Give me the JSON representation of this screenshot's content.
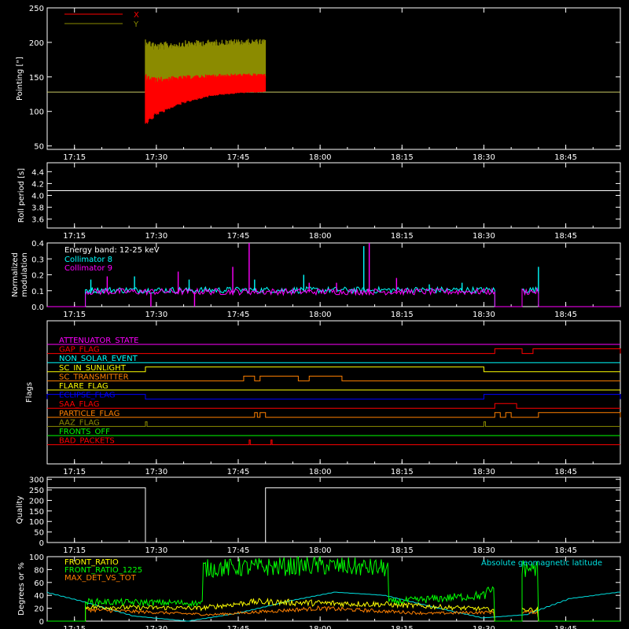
{
  "chart_data": [
    {
      "id": "pointing",
      "type": "line",
      "ylabel": "Pointing [\"]",
      "ylim": [
        45,
        250
      ],
      "yticks": [
        50,
        100,
        150,
        200,
        250
      ],
      "xlim": [
        "17:10",
        "18:55"
      ],
      "xticks": [
        "17:15",
        "17:30",
        "17:45",
        "18:00",
        "18:15",
        "18:30",
        "18:45"
      ],
      "legend": "top-left",
      "series": [
        {
          "name": "X",
          "color": "#ff0000",
          "t_start": "17:28",
          "t_end": "17:50",
          "points": [
            [
              "17:28",
              100
            ],
            [
              "17:30",
              118
            ],
            [
              "17:35",
              130
            ],
            [
              "17:40",
              136
            ],
            [
              "17:45",
              139
            ],
            [
              "17:50",
              140
            ]
          ],
          "band_high": [
            [
              "17:28",
              155
            ],
            [
              "17:30",
              150
            ],
            [
              "17:35",
              152
            ],
            [
              "17:40",
              154
            ],
            [
              "17:45",
              155
            ],
            [
              "17:50",
              155
            ]
          ],
          "band_low": [
            [
              "17:28",
              82
            ],
            [
              "17:30",
              95
            ],
            [
              "17:35",
              112
            ],
            [
              "17:40",
              122
            ],
            [
              "17:45",
              126
            ],
            [
              "17:50",
              128
            ]
          ]
        },
        {
          "name": "Y",
          "color": "#8b8b00",
          "t_start": "17:28",
          "t_end": "17:50",
          "band_high": [
            [
              "17:28",
              208
            ],
            [
              "17:30",
              200
            ],
            [
              "17:35",
              203
            ],
            [
              "17:40",
              204
            ],
            [
              "17:45",
              205
            ],
            [
              "17:50",
              205
            ]
          ],
          "band_low": [
            [
              "17:28",
              125
            ],
            [
              "17:30",
              120
            ],
            [
              "17:35",
              135
            ],
            [
              "17:40",
              142
            ],
            [
              "17:45",
              146
            ],
            [
              "17:50",
              148
            ]
          ]
        }
      ],
      "reference_line": {
        "value": 128,
        "color": "#c8c864"
      }
    },
    {
      "id": "roll",
      "type": "line",
      "ylabel": "Roll period [s]",
      "ylim": [
        3.45,
        4.55
      ],
      "yticks": [
        3.6,
        3.8,
        4.0,
        4.2,
        4.4
      ],
      "xticks": [
        "17:15",
        "17:30",
        "17:45",
        "18:00",
        "18:15",
        "18:30",
        "18:45"
      ],
      "series": [
        {
          "name": "",
          "color": "#ffffff",
          "points": [
            [
              "17:10",
              4.08
            ],
            [
              "18:55",
              4.08
            ]
          ]
        }
      ]
    },
    {
      "id": "modulation",
      "type": "line",
      "ylabel_lines": [
        "Normalized",
        "modulation"
      ],
      "ylim": [
        0,
        0.4
      ],
      "yticks": [
        0.0,
        0.1,
        0.2,
        0.3,
        0.4
      ],
      "xticks": [
        "17:15",
        "17:30",
        "17:45",
        "18:00",
        "18:15",
        "18:30",
        "18:45"
      ],
      "legend_text": "Energy band: 12-25 keV",
      "series": [
        {
          "name": "Collimator 8",
          "color": "#00ffff",
          "active": [
            [
              "17:17",
              "18:32"
            ],
            [
              "18:37",
              "18:40"
            ]
          ],
          "base": 0.1,
          "spikes": [
            [
              "17:18",
              0.17
            ],
            [
              "17:26",
              0.19
            ],
            [
              "17:36",
              0.17
            ],
            [
              "17:48",
              0.17
            ],
            [
              "17:57",
              0.2
            ],
            [
              "18:08",
              0.38
            ],
            [
              "18:20",
              0.14
            ],
            [
              "18:26",
              0.15
            ],
            [
              "18:40",
              0.25
            ]
          ]
        },
        {
          "name": "Collimator 9",
          "color": "#ff00ff",
          "active": [
            [
              "17:17",
              "18:32"
            ],
            [
              "18:37",
              "18:40"
            ]
          ],
          "base": 0.09,
          "spikes": [
            [
              "17:21",
              0.19
            ],
            [
              "17:34",
              0.22
            ],
            [
              "17:44",
              0.25
            ],
            [
              "17:47",
              0.4
            ],
            [
              "17:58",
              0.15
            ],
            [
              "18:03",
              0.15
            ],
            [
              "18:09",
              0.4
            ],
            [
              "18:14",
              0.18
            ]
          ],
          "dips": [
            "17:29",
            "17:37"
          ]
        }
      ]
    },
    {
      "id": "flags",
      "type": "line",
      "ylabel": "Flags",
      "xticks": [
        "17:15",
        "17:30",
        "17:45",
        "18:00",
        "18:15",
        "18:30",
        "18:45"
      ],
      "series": [
        {
          "name": "ATTENUATOR_STATE",
          "color": "#ff00ff",
          "on": []
        },
        {
          "name": "GAP_FLAG",
          "color": "#ff0000",
          "on": [
            [
              "18:32",
              "18:37"
            ],
            [
              "18:39",
              "18:55"
            ]
          ]
        },
        {
          "name": "NON_SOLAR_EVENT",
          "color": "#00ffff",
          "on": []
        },
        {
          "name": "SC_IN_SUNLIGHT",
          "color": "#ffff00",
          "on": [
            [
              "17:28",
              "18:30"
            ]
          ]
        },
        {
          "name": "SC_TRANSMITTER",
          "color": "#ff8000",
          "on": [
            [
              "17:46",
              "17:48"
            ],
            [
              "17:49",
              "17:56"
            ],
            [
              "17:58",
              "18:04"
            ]
          ]
        },
        {
          "name": "FLARE_FLAG",
          "color": "#ffff00",
          "on": []
        },
        {
          "name": "ECLIPSE_FLAG",
          "color": "#0000ff",
          "on": [
            [
              "17:10",
              "17:28"
            ],
            [
              "18:30",
              "18:55"
            ]
          ]
        },
        {
          "name": "SAA_FLAG",
          "color": "#ff0000",
          "on": [
            [
              "18:32",
              "18:36"
            ]
          ]
        },
        {
          "name": "PARTICLE_FLAG",
          "color": "#ff8000",
          "on": [
            [
              "17:48",
              "17:48.5"
            ],
            [
              "17:49",
              "17:50"
            ],
            [
              "18:32",
              "18:33"
            ],
            [
              "18:34",
              "18:35"
            ],
            [
              "18:40",
              "18:55"
            ]
          ]
        },
        {
          "name": "AAZ_FLAG",
          "color": "#8b8b00",
          "on": [
            [
              "17:28",
              "17:28.3"
            ],
            [
              "18:30",
              "18:30.3"
            ]
          ]
        },
        {
          "name": "FRONTS_OFF",
          "color": "#00ff00",
          "on": []
        },
        {
          "name": "BAD_PACKETS",
          "color": "#ff0000",
          "on": [
            [
              "17:47",
              "17:47.2"
            ],
            [
              "17:51",
              "17:51.2"
            ]
          ]
        }
      ]
    },
    {
      "id": "quality",
      "type": "line",
      "ylabel": "Quality",
      "ylim": [
        0,
        310
      ],
      "yticks": [
        0,
        50,
        100,
        150,
        200,
        250,
        300
      ],
      "xticks": [
        "17:15",
        "17:30",
        "17:45",
        "18:00",
        "18:15",
        "18:30",
        "18:45"
      ],
      "series": [
        {
          "name": "",
          "color": "#ffffff",
          "points": [
            [
              "17:10",
              260
            ],
            [
              "17:28",
              260
            ],
            [
              "17:28",
              0
            ],
            [
              "17:50",
              0
            ],
            [
              "17:50",
              260
            ],
            [
              "18:55",
              260
            ]
          ]
        }
      ]
    },
    {
      "id": "ratios",
      "type": "line",
      "ylabel": "Degrees or %",
      "ylim": [
        0,
        100
      ],
      "yticks": [
        0,
        20,
        40,
        60,
        80,
        100
      ],
      "xticks": [
        "17:15",
        "17:30",
        "17:45",
        "18:00",
        "18:15",
        "18:30",
        "18:45"
      ],
      "series": [
        {
          "name": "FRONT_RATIO",
          "color": "#ffff00",
          "active": [
            [
              "17:17",
              "18:32"
            ],
            [
              "18:37",
              "18:40"
            ]
          ],
          "levels": [
            [
              "17:17",
              22
            ],
            [
              "17:38",
              20
            ],
            [
              "17:48",
              30
            ],
            [
              "18:00",
              28
            ],
            [
              "18:12",
              26
            ],
            [
              "18:32",
              18
            ]
          ]
        },
        {
          "name": "FRONT_RATIO_1225",
          "color": "#00ff00",
          "active": [
            [
              "17:17",
              "18:32"
            ],
            [
              "18:37",
              "18:40"
            ]
          ],
          "levels": [
            [
              "17:17",
              30
            ],
            [
              "17:38",
              28
            ],
            [
              "17:39",
              82
            ],
            [
              "17:50",
              84
            ],
            [
              "18:00",
              86
            ],
            [
              "18:12",
              82
            ],
            [
              "18:13",
              30
            ],
            [
              "18:30",
              40
            ],
            [
              "18:37",
              82
            ],
            [
              "18:40",
              82
            ]
          ]
        },
        {
          "name": "MAX_DET_VS_TOT",
          "color": "#ff8000",
          "active": [
            [
              "17:17",
              "18:32"
            ],
            [
              "18:37",
              "18:40"
            ]
          ],
          "levels": [
            [
              "17:17",
              18
            ],
            [
              "17:40",
              10
            ],
            [
              "18:00",
              20
            ],
            [
              "18:20",
              12
            ],
            [
              "18:32",
              14
            ]
          ]
        },
        {
          "name": "Absolute geomagnetic latitude",
          "color": "#00e0e0",
          "points": [
            [
              "17:10",
              45
            ],
            [
              "17:17",
              30
            ],
            [
              "17:26",
              8
            ],
            [
              "17:36",
              0
            ],
            [
              "17:45",
              12
            ],
            [
              "17:55",
              32
            ],
            [
              "18:03",
              45
            ],
            [
              "18:12",
              40
            ],
            [
              "18:22",
              20
            ],
            [
              "18:30",
              5
            ],
            [
              "18:38",
              10
            ],
            [
              "18:46",
              35
            ],
            [
              "18:55",
              45
            ]
          ]
        }
      ]
    }
  ]
}
